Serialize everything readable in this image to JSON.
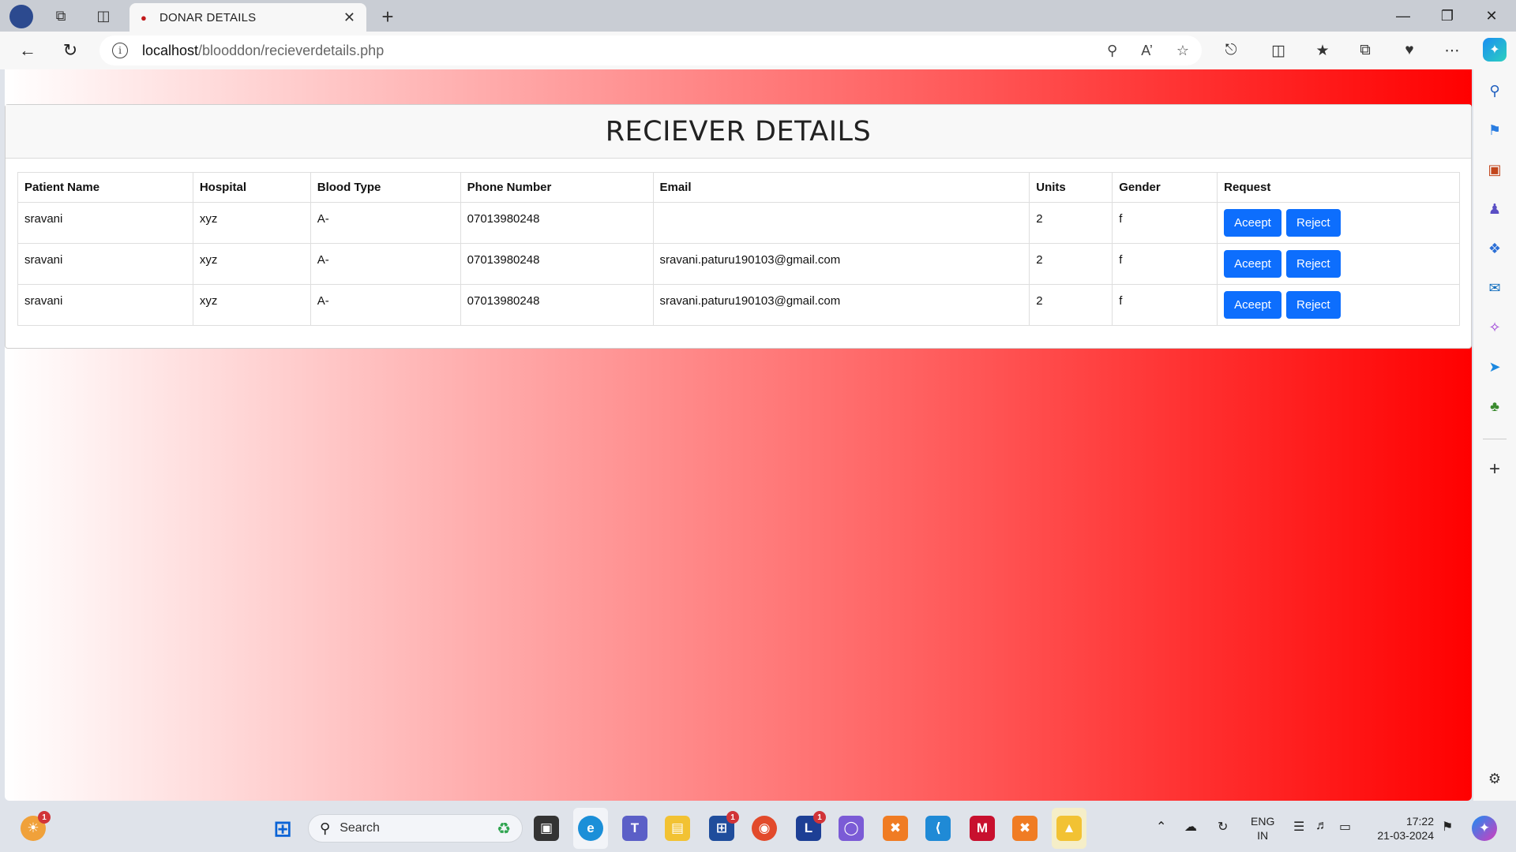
{
  "browser": {
    "tab_title": "DONAR DETAILS",
    "url_host": "localhost",
    "url_path": "/blooddon/recieverdetails.php"
  },
  "page": {
    "heading": "RECIEVER DETAILS",
    "columns": [
      "Patient Name",
      "Hospital",
      "Blood Type",
      "Phone Number",
      "Email",
      "Units",
      "Gender",
      "Request"
    ],
    "rows": [
      {
        "name": "sravani",
        "hospital": "xyz",
        "blood": "A-",
        "phone": "07013980248",
        "email": "",
        "units": "2",
        "gender": "f"
      },
      {
        "name": "sravani",
        "hospital": "xyz",
        "blood": "A-",
        "phone": "07013980248",
        "email": "sravani.paturu190103@gmail.com",
        "units": "2",
        "gender": "f"
      },
      {
        "name": "sravani",
        "hospital": "xyz",
        "blood": "A-",
        "phone": "07013980248",
        "email": "sravani.paturu190103@gmail.com",
        "units": "2",
        "gender": "f"
      }
    ],
    "accept_label": "Aceept",
    "reject_label": "Reject",
    "gradient": {
      "from": "#ffffff",
      "to": "#ff0000"
    },
    "button_color": "#0d6efd"
  },
  "taskbar": {
    "search_label": "Search",
    "weather_badge": "1",
    "store_badge": "1",
    "l_badge": "1",
    "lang_top": "ENG",
    "lang_bottom": "IN",
    "time": "17:22",
    "date": "21-03-2024"
  }
}
